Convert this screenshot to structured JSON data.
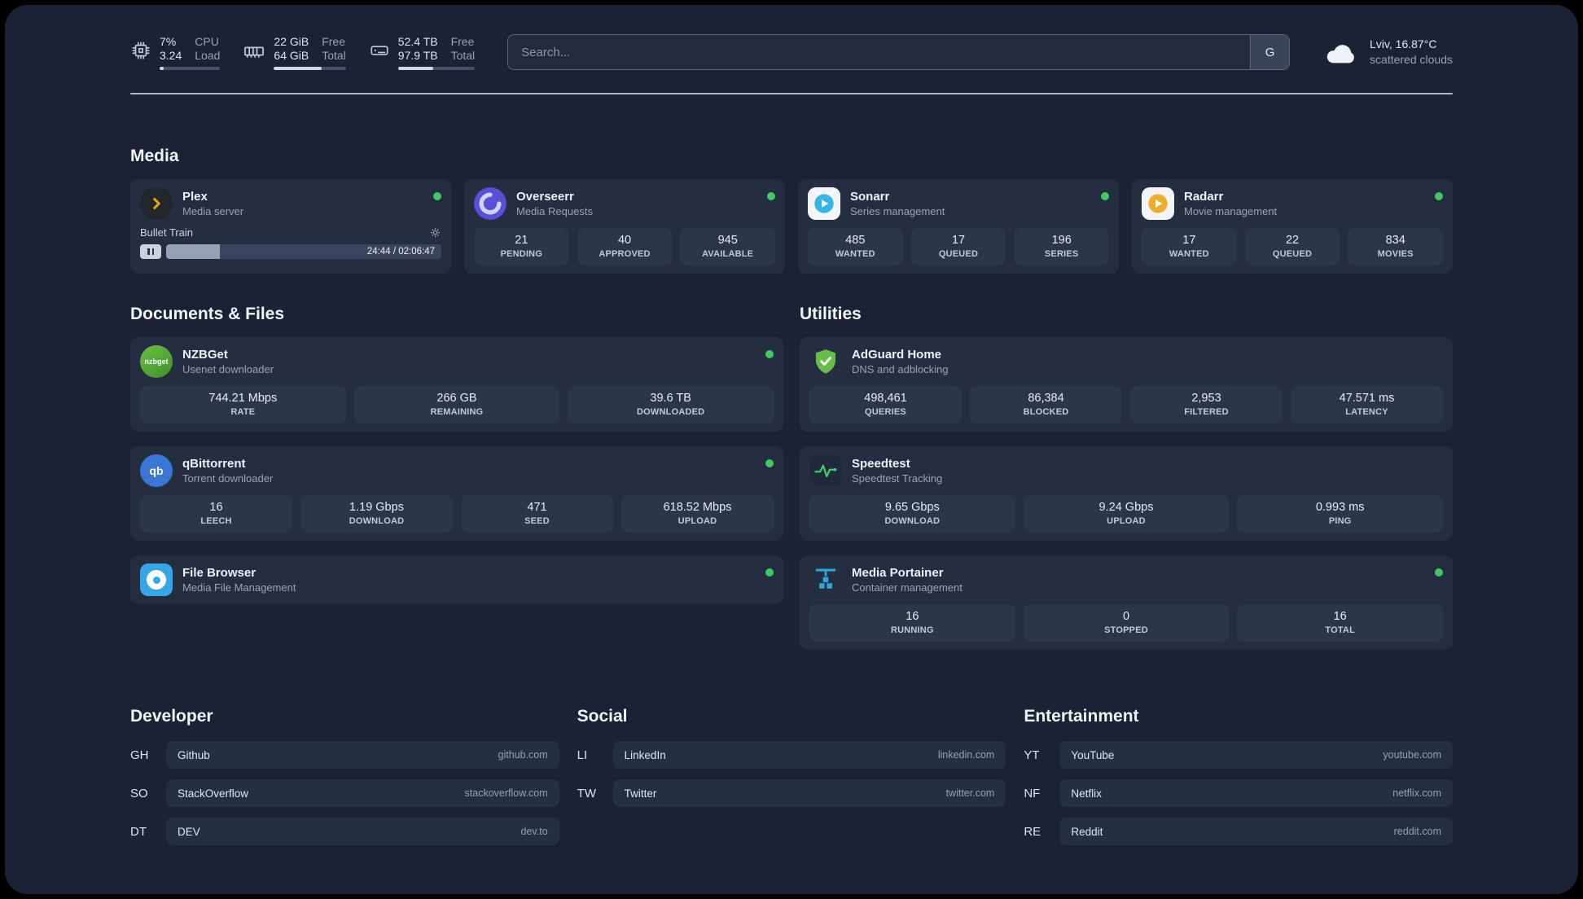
{
  "topbar": {
    "resources": [
      {
        "value_top": "7%",
        "label_top": "CPU",
        "value_bottom": "3.24",
        "label_bottom": "Load",
        "percent": 7
      },
      {
        "value_top": "22 GiB",
        "label_top": "Free",
        "value_bottom": "64 GiB",
        "label_bottom": "Total",
        "percent": 66
      },
      {
        "value_top": "52.4 TB",
        "label_top": "Free",
        "value_bottom": "97.9 TB",
        "label_bottom": "Total",
        "percent": 46
      }
    ],
    "search": {
      "placeholder": "Search...",
      "button_label": "G"
    },
    "weather": {
      "location": "Lviv, 16.87°C",
      "condition": "scattered clouds"
    }
  },
  "sections": {
    "media": {
      "heading": "Media",
      "plex": {
        "name": "Plex",
        "subtitle": "Media server",
        "status": "online",
        "player": {
          "title": "Bullet Train",
          "time": "24:44 / 02:06:47",
          "progress_percent": 19.5
        }
      },
      "overseerr": {
        "name": "Overseerr",
        "subtitle": "Media Requests",
        "status": "online",
        "stats": [
          {
            "value": "21",
            "label": "PENDING"
          },
          {
            "value": "40",
            "label": "APPROVED"
          },
          {
            "value": "945",
            "label": "AVAILABLE"
          }
        ]
      },
      "sonarr": {
        "name": "Sonarr",
        "subtitle": "Series management",
        "status": "online",
        "stats": [
          {
            "value": "485",
            "label": "WANTED"
          },
          {
            "value": "17",
            "label": "QUEUED"
          },
          {
            "value": "196",
            "label": "SERIES"
          }
        ]
      },
      "radarr": {
        "name": "Radarr",
        "subtitle": "Movie management",
        "status": "online",
        "stats": [
          {
            "value": "17",
            "label": "WANTED"
          },
          {
            "value": "22",
            "label": "QUEUED"
          },
          {
            "value": "834",
            "label": "MOVIES"
          }
        ]
      }
    },
    "documents": {
      "heading": "Documents & Files",
      "nzbget": {
        "name": "NZBGet",
        "subtitle": "Usenet downloader",
        "status": "online",
        "stats": [
          {
            "value": "744.21 Mbps",
            "label": "RATE"
          },
          {
            "value": "266 GB",
            "label": "REMAINING"
          },
          {
            "value": "39.6 TB",
            "label": "DOWNLOADED"
          }
        ]
      },
      "qbittorrent": {
        "name": "qBittorrent",
        "subtitle": "Torrent downloader",
        "status": "online",
        "stats": [
          {
            "value": "16",
            "label": "LEECH"
          },
          {
            "value": "1.19 Gbps",
            "label": "DOWNLOAD"
          },
          {
            "value": "471",
            "label": "SEED"
          },
          {
            "value": "618.52 Mbps",
            "label": "UPLOAD"
          }
        ]
      },
      "filebrowser": {
        "name": "File Browser",
        "subtitle": "Media File Management",
        "status": "online"
      }
    },
    "utilities": {
      "heading": "Utilities",
      "adguard": {
        "name": "AdGuard Home",
        "subtitle": "DNS and adblocking",
        "stats": [
          {
            "value": "498,461",
            "label": "QUERIES"
          },
          {
            "value": "86,384",
            "label": "BLOCKED"
          },
          {
            "value": "2,953",
            "label": "FILTERED"
          },
          {
            "value": "47.571 ms",
            "label": "LATENCY"
          }
        ]
      },
      "speedtest": {
        "name": "Speedtest",
        "subtitle": "Speedtest Tracking",
        "stats": [
          {
            "value": "9.65 Gbps",
            "label": "DOWNLOAD"
          },
          {
            "value": "9.24 Gbps",
            "label": "UPLOAD"
          },
          {
            "value": "0.993 ms",
            "label": "PING"
          }
        ]
      },
      "portainer": {
        "name": "Media Portainer",
        "subtitle": "Container management",
        "status": "online",
        "stats": [
          {
            "value": "16",
            "label": "RUNNING"
          },
          {
            "value": "0",
            "label": "STOPPED"
          },
          {
            "value": "16",
            "label": "TOTAL"
          }
        ]
      }
    }
  },
  "bookmarks": {
    "developer": {
      "heading": "Developer",
      "items": [
        {
          "abbr": "GH",
          "name": "Github",
          "url": "github.com"
        },
        {
          "abbr": "SO",
          "name": "StackOverflow",
          "url": "stackoverflow.com"
        },
        {
          "abbr": "DT",
          "name": "DEV",
          "url": "dev.to"
        }
      ]
    },
    "social": {
      "heading": "Social",
      "items": [
        {
          "abbr": "LI",
          "name": "LinkedIn",
          "url": "linkedin.com"
        },
        {
          "abbr": "TW",
          "name": "Twitter",
          "url": "twitter.com"
        }
      ]
    },
    "entertainment": {
      "heading": "Entertainment",
      "items": [
        {
          "abbr": "YT",
          "name": "YouTube",
          "url": "youtube.com"
        },
        {
          "abbr": "NF",
          "name": "Netflix",
          "url": "netflix.com"
        },
        {
          "abbr": "RE",
          "name": "Reddit",
          "url": "reddit.com"
        }
      ]
    }
  },
  "colors": {
    "background": "#1a2233",
    "card": "#242e40",
    "tile": "#2c3649",
    "status_online": "#43c961",
    "plex": "#e5a00d",
    "overseerr": "#5a4fd7",
    "sonarr": "#35b5e5",
    "radarr": "#f0ad2d",
    "nzbget": "#57a62e",
    "qbittorrent": "#3a76d6",
    "filebrowser": "#37a6e4",
    "adguard": "#68bc4a",
    "speedtest": "#3fd06c",
    "portainer": "#2ba7dc"
  }
}
